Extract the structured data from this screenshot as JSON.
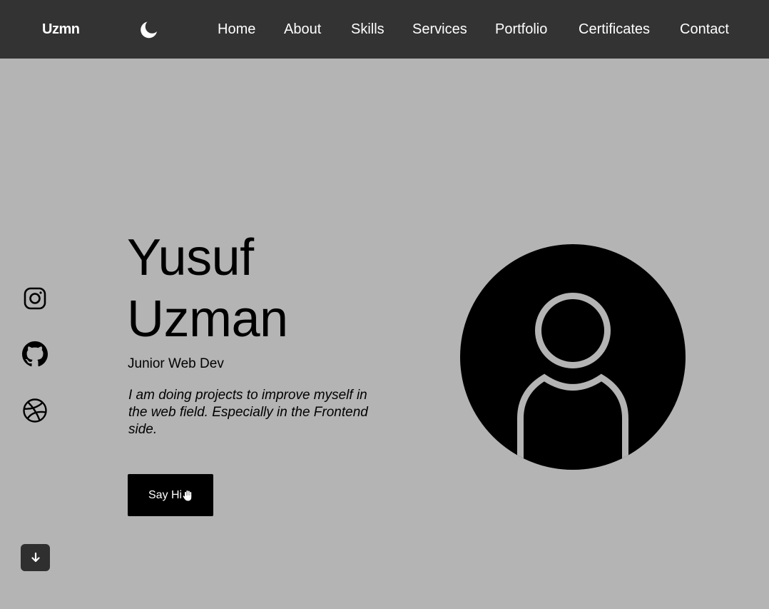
{
  "header": {
    "logo": "Uzmn",
    "theme_toggle_icon": "moon-icon",
    "nav": [
      "Home",
      "About",
      "Skills",
      "Services",
      "Portfolio",
      "Certificates",
      "Contact"
    ]
  },
  "social": [
    {
      "icon": "instagram-icon"
    },
    {
      "icon": "github-icon"
    },
    {
      "icon": "dribbble-icon"
    }
  ],
  "hero": {
    "first_name": "Yusuf",
    "last_name": "Uzman",
    "role": "Junior Web Dev",
    "bio": "I am doing projects to improve myself in the web field. Especially in the Frontend side.",
    "cta_label": "Say Hi",
    "cta_icon": "hand-wave-icon",
    "avatar_icon": "user-avatar-icon"
  },
  "scroll_icon": "arrow-down-icon",
  "colors": {
    "background": "#b4b4b4",
    "header": "#333333",
    "text": "#000000",
    "accent": "#000000",
    "button_dark": "#2f2f2f"
  }
}
